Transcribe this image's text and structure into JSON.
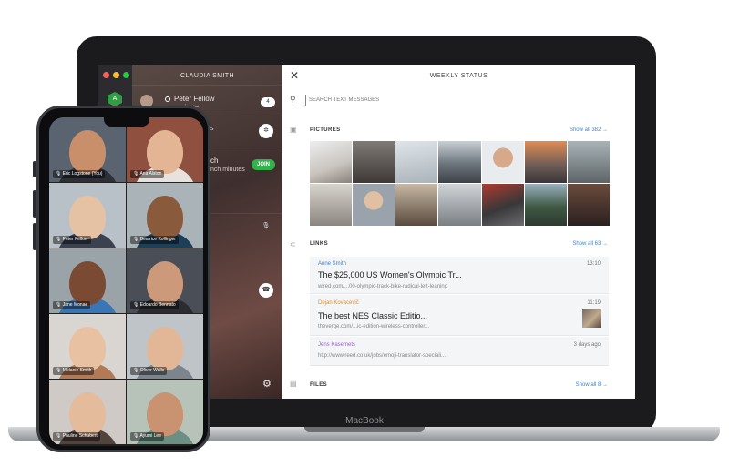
{
  "laptop": {
    "brand": "MacBook",
    "window_buttons": [
      "#ff5f57",
      "#febc2e",
      "#28c840"
    ],
    "app_logo_letter": "A",
    "chat_list": {
      "title": "CLAUDIA SMITH",
      "rows": [
        {
          "name": "Peter Fellow",
          "sub": "a minute",
          "badge": "4"
        },
        {
          "name": "",
          "sub": "s",
          "badge": ""
        },
        {
          "name": "",
          "sub": "ch",
          "detail": "nch minutes",
          "badge": "JOIN"
        }
      ],
      "settings_icon": "gear-icon"
    },
    "panel": {
      "title": "WEEKLY STATUS",
      "close_icon": "close-icon",
      "search_placeholder": "SEARCH TEXT MESSAGES",
      "pictures": {
        "heading": "PICTURES",
        "show_all": "Show all 382 →"
      },
      "links": {
        "heading": "LINKS",
        "show_all": "Show all 63 →",
        "items": [
          {
            "author": "Anne Smith",
            "author_color": "#3a84d6",
            "date": "13:10",
            "title": "The $25,000 US Women's Olympic Tr...",
            "url": "wired.com/...00-olympic-track-bike-radical-left-leaning"
          },
          {
            "author": "Dejan Kovacevič",
            "author_color": "#e98a1f",
            "date": "11:19",
            "title": "The best NES Classic Editio...",
            "url": "theverge.com/...ic-edition-wireless-controller..."
          },
          {
            "author": "Jens Kasemets",
            "author_color": "#a35fd0",
            "date": "3 days ago",
            "title": "",
            "url": "http://www.reed.co.uk/jobs/emoji-translator-speciali..."
          }
        ]
      },
      "files": {
        "heading": "FILES",
        "show_all": "Show all 8 →"
      }
    }
  },
  "phone": {
    "participants": [
      {
        "name": "Eric Logstone (You)",
        "skin": "#c98e6a",
        "bg": "#5a6470",
        "shirt": "#2d2f36"
      },
      {
        "name": "Ana Alston",
        "skin": "#e3b595",
        "bg": "#8f5040",
        "shirt": "#e7e2dd"
      },
      {
        "name": "Peter Fellow",
        "skin": "#e6c2a4",
        "bg": "#b9c1c8",
        "shirt": "#3a4250"
      },
      {
        "name": "Beatrice Kollinger",
        "skin": "#8a5a3c",
        "bg": "#a9b3b8",
        "shirt": "#1e3f58"
      },
      {
        "name": "Jane Monae",
        "skin": "#7b4a32",
        "bg": "#9aa4a8",
        "shirt": "#3976b5"
      },
      {
        "name": "Edoardo Bennato",
        "skin": "#cc9a7a",
        "bg": "#4a4e56",
        "shirt": "#2a2c31"
      },
      {
        "name": "Melanie Smith",
        "skin": "#e8c1a2",
        "bg": "#d9d6d2",
        "shirt": "#b27a57"
      },
      {
        "name": "Oliver Walls",
        "skin": "#e2b798",
        "bg": "#bfc4c8",
        "shirt": "#7c858d"
      },
      {
        "name": "Pauline Schubert",
        "skin": "#e4bb9b",
        "bg": "#cfcac5",
        "shirt": "#51443d"
      },
      {
        "name": "Ayumi Lee",
        "skin": "#c99270",
        "bg": "#b7c2b9",
        "shirt": "#6b8f82"
      }
    ]
  }
}
